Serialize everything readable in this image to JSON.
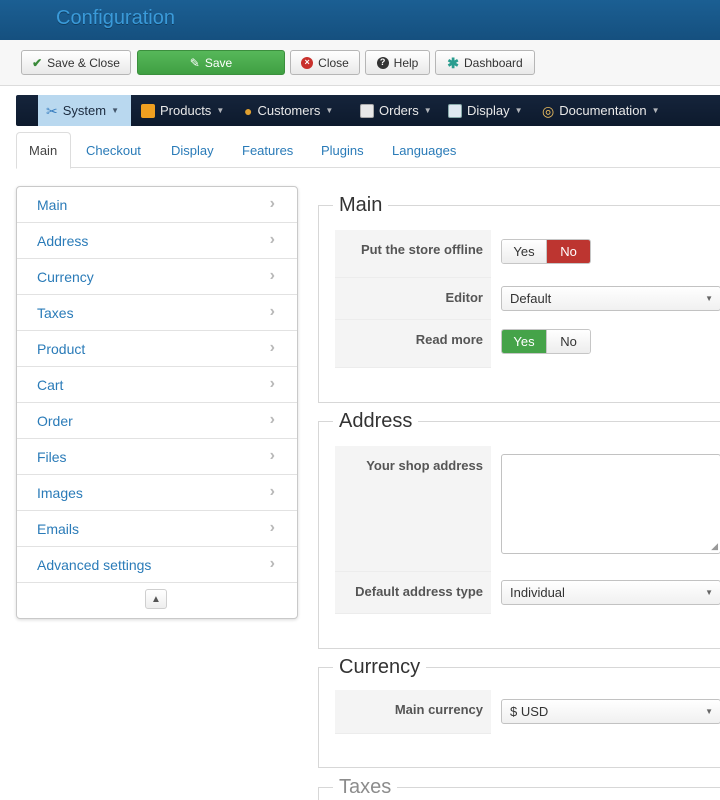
{
  "header": {
    "title": "Configuration"
  },
  "toolbar": {
    "save_close": "Save & Close",
    "save": "Save",
    "close": "Close",
    "help": "Help",
    "dashboard": "Dashboard"
  },
  "navbar": {
    "items": [
      {
        "label": "System",
        "icon": "wrench-icon",
        "active": true
      },
      {
        "label": "Products",
        "icon": "box-icon"
      },
      {
        "label": "Customers",
        "icon": "users-icon"
      },
      {
        "label": "Orders",
        "icon": "orders-icon"
      },
      {
        "label": "Display",
        "icon": "display-icon"
      },
      {
        "label": "Documentation",
        "icon": "lifebuoy-icon"
      }
    ]
  },
  "tabs": [
    "Main",
    "Checkout",
    "Display",
    "Features",
    "Plugins",
    "Languages"
  ],
  "sidemenu": {
    "items": [
      "Main",
      "Address",
      "Currency",
      "Taxes",
      "Product",
      "Cart",
      "Order",
      "Files",
      "Images",
      "Emails",
      "Advanced settings"
    ]
  },
  "sections": {
    "main": {
      "legend": "Main",
      "offline_label": "Put the store offline",
      "offline_yes": "Yes",
      "offline_no": "No",
      "editor_label": "Editor",
      "editor_value": "Default",
      "readmore_label": "Read more",
      "readmore_yes": "Yes",
      "readmore_no": "No"
    },
    "address": {
      "legend": "Address",
      "shop_address_label": "Your shop address",
      "shop_address_value": "",
      "default_type_label": "Default address type",
      "default_type_value": "Individual"
    },
    "currency": {
      "legend": "Currency",
      "main_currency_label": "Main currency",
      "main_currency_value": "$ USD"
    },
    "taxes": {
      "legend": "Taxes"
    }
  },
  "colors": {
    "header_bg": "#15507f",
    "title_text": "#3a9ad9",
    "navbar_bg": "#0d1a2d",
    "nav_active_bg": "#b9d8ef",
    "link_blue": "#2a7bb8",
    "save_green": "#45a349",
    "toggle_no_red": "#bd3530"
  }
}
